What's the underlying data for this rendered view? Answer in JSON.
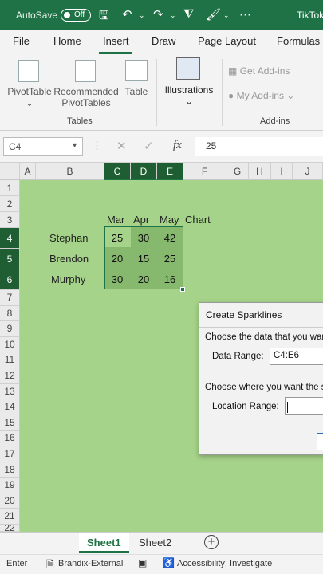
{
  "titlebar": {
    "autosave": "AutoSave",
    "toggle_state": "Off",
    "doc_title": "TikTok"
  },
  "tabs": [
    "File",
    "Home",
    "Insert",
    "Draw",
    "Page Layout",
    "Formulas"
  ],
  "ribbon": {
    "pivottable": "PivotTable",
    "recommended_l1": "Recommended",
    "recommended_l2": "PivotTables",
    "table": "Table",
    "illustrations": "Illustrations",
    "get_addins": "Get Add-ins",
    "my_addins": "My Add-ins",
    "group_tables": "Tables",
    "group_addins": "Add-ins"
  },
  "formula_bar": {
    "name_box": "C4",
    "value": "25"
  },
  "columns": [
    "A",
    "B",
    "C",
    "D",
    "E",
    "F",
    "G",
    "H",
    "I",
    "J"
  ],
  "rows": [
    "1",
    "2",
    "3",
    "4",
    "5",
    "6",
    "7",
    "8",
    "9",
    "10",
    "11",
    "12",
    "13",
    "14",
    "15",
    "16",
    "17",
    "18",
    "19",
    "20",
    "21",
    "22"
  ],
  "sheet": {
    "headers": {
      "c": "Mar",
      "d": "Apr",
      "e": "May",
      "f": "Chart"
    },
    "names": [
      "Stephan",
      "Brendon",
      "Murphy"
    ],
    "data": [
      [
        "25",
        "30",
        "42"
      ],
      [
        "20",
        "15",
        "25"
      ],
      [
        "30",
        "20",
        "16"
      ]
    ]
  },
  "dialog": {
    "title": "Create Sparklines",
    "choose_data": "Choose the data that you want",
    "data_range_label": "Data Range:",
    "data_range_value": "C4:E6",
    "choose_location": "Choose where you want the s",
    "location_range_label": "Location Range:",
    "location_range_value": ""
  },
  "sheets": [
    "Sheet1",
    "Sheet2"
  ],
  "status": {
    "mode": "Enter",
    "label": "Brandix-External",
    "accessibility": "Accessibility: Investigate"
  },
  "colors": {
    "accent": "#1f7245",
    "sheet_bg": "#a6d38a",
    "shade": "#86b86d"
  }
}
